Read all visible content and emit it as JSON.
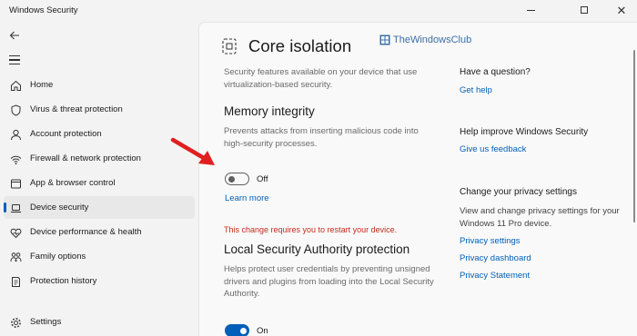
{
  "window": {
    "title": "Windows Security"
  },
  "colors": {
    "accent": "#005fb8",
    "warning": "#c42b1c",
    "annotation_arrow": "#e02020"
  },
  "sidebar": {
    "back_icon": "back-arrow-icon",
    "menu_icon": "hamburger-menu-icon",
    "items": [
      {
        "label": "Home",
        "icon": "home-icon"
      },
      {
        "label": "Virus & threat protection",
        "icon": "shield-icon"
      },
      {
        "label": "Account protection",
        "icon": "person-icon"
      },
      {
        "label": "Firewall & network protection",
        "icon": "wifi-icon"
      },
      {
        "label": "App & browser control",
        "icon": "app-browser-icon"
      },
      {
        "label": "Device security",
        "icon": "laptop-icon",
        "selected": true
      },
      {
        "label": "Device performance & health",
        "icon": "heart-icon"
      },
      {
        "label": "Family options",
        "icon": "family-icon"
      },
      {
        "label": "Protection history",
        "icon": "history-icon"
      },
      {
        "label": "Settings",
        "icon": "gear-icon"
      }
    ]
  },
  "main": {
    "title": "Core isolation",
    "title_icon": "core-isolation-icon",
    "watermark": "TheWindowsClub",
    "intro": "Security features available on your device that use virtualization-based security.",
    "memory_integrity": {
      "title": "Memory integrity",
      "description": "Prevents attacks from inserting malicious code into high-security processes.",
      "toggle_state": "Off",
      "learn_more": "Learn more"
    },
    "restart_warning": "This change requires you to restart your device.",
    "lsa": {
      "title": "Local Security Authority protection",
      "description": "Helps protect user credentials by preventing unsigned drivers and plugins from loading into the Local Security Authority.",
      "toggle_state": "On"
    }
  },
  "right_column": {
    "question_heading": "Have a question?",
    "get_help": "Get help",
    "improve_heading": "Help improve Windows Security",
    "feedback": "Give us feedback",
    "privacy_heading": "Change your privacy settings",
    "privacy_desc": "View and change privacy settings for your Windows 11 Pro device.",
    "privacy_links": [
      "Privacy settings",
      "Privacy dashboard",
      "Privacy Statement"
    ]
  }
}
